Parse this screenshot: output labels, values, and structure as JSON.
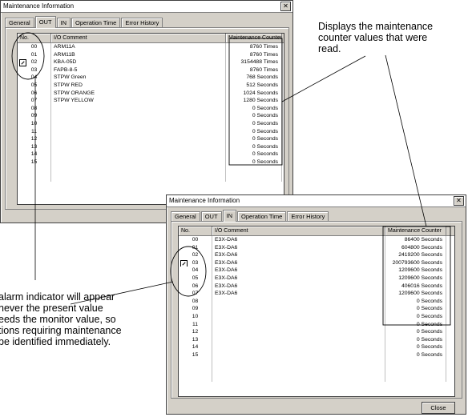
{
  "window1": {
    "title": "Maintenance Information",
    "close_glyph": "✕",
    "tabs": [
      "General",
      "OUT",
      "IN",
      "Operation Time",
      "Error History"
    ],
    "active_tab": 1,
    "headers": {
      "no": "No.",
      "comment": "I/O Comment",
      "counter": "Maintenance Counter"
    },
    "alarm_row": 2,
    "rows": [
      {
        "no": "00",
        "comment": "ARM11A",
        "counter": "8760 Times"
      },
      {
        "no": "01",
        "comment": "ARM11B",
        "counter": "8760 Times"
      },
      {
        "no": "02",
        "comment": "KBA-05D",
        "counter": "3154488 Times"
      },
      {
        "no": "03",
        "comment": "FAPB-8-5",
        "counter": "8760 Times"
      },
      {
        "no": "04",
        "comment": "STPW Green",
        "counter": "768 Seconds"
      },
      {
        "no": "05",
        "comment": "STPW RED",
        "counter": "512 Seconds"
      },
      {
        "no": "06",
        "comment": "STPW ORANGE",
        "counter": "1024 Seconds"
      },
      {
        "no": "07",
        "comment": "STPW YELLOW",
        "counter": "1280 Seconds"
      },
      {
        "no": "08",
        "comment": "",
        "counter": "0 Seconds"
      },
      {
        "no": "09",
        "comment": "",
        "counter": "0 Seconds"
      },
      {
        "no": "10",
        "comment": "",
        "counter": "0 Seconds"
      },
      {
        "no": "11",
        "comment": "",
        "counter": "0 Seconds"
      },
      {
        "no": "12",
        "comment": "",
        "counter": "0 Seconds"
      },
      {
        "no": "13",
        "comment": "",
        "counter": "0 Seconds"
      },
      {
        "no": "14",
        "comment": "",
        "counter": "0 Seconds"
      },
      {
        "no": "15",
        "comment": "",
        "counter": "0 Seconds"
      },
      {
        "no": "",
        "comment": "",
        "counter": ""
      },
      {
        "no": "",
        "comment": "",
        "counter": ""
      }
    ]
  },
  "window2": {
    "title": "Maintenance Information",
    "close_glyph": "✕",
    "tabs": [
      "General",
      "OUT",
      "IN",
      "Operation Time",
      "Error History"
    ],
    "active_tab": 2,
    "headers": {
      "no": "No.",
      "comment": "I/O Comment",
      "counter": "Maintenance Counter"
    },
    "alarm_row": 3,
    "rows": [
      {
        "no": "00",
        "comment": "E3X-DA6",
        "counter": "86400 Seconds"
      },
      {
        "no": "01",
        "comment": "E3X-DA6",
        "counter": "604800 Seconds"
      },
      {
        "no": "02",
        "comment": "E3X-DA6",
        "counter": "2419200 Seconds"
      },
      {
        "no": "03",
        "comment": "E3X-DA6",
        "counter": "200793600 Seconds"
      },
      {
        "no": "04",
        "comment": "E3X-DA6",
        "counter": "1209600 Seconds"
      },
      {
        "no": "05",
        "comment": "E3X-DA6",
        "counter": "1209600 Seconds"
      },
      {
        "no": "06",
        "comment": "E3X-DA6",
        "counter": "406016 Seconds"
      },
      {
        "no": "07",
        "comment": "E3X-DA6",
        "counter": "1209600 Seconds"
      },
      {
        "no": "08",
        "comment": "",
        "counter": "0 Seconds"
      },
      {
        "no": "09",
        "comment": "",
        "counter": "0 Seconds"
      },
      {
        "no": "10",
        "comment": "",
        "counter": "0 Seconds"
      },
      {
        "no": "11",
        "comment": "",
        "counter": "0 Seconds"
      },
      {
        "no": "12",
        "comment": "",
        "counter": "0 Seconds"
      },
      {
        "no": "13",
        "comment": "",
        "counter": "0 Seconds"
      },
      {
        "no": "14",
        "comment": "",
        "counter": "0 Seconds"
      },
      {
        "no": "15",
        "comment": "",
        "counter": "0 Seconds"
      },
      {
        "no": "",
        "comment": "",
        "counter": ""
      },
      {
        "no": "",
        "comment": "",
        "counter": ""
      },
      {
        "no": "",
        "comment": "",
        "counter": ""
      }
    ],
    "close_button": "Close"
  },
  "callouts": {
    "top_right": [
      "Displays the maintenance",
      "counter values that were",
      "read."
    ],
    "bottom_left": [
      "alarm indicator will appear",
      "never the present value",
      "eeds the monitor value, so",
      "tions requiring maintenance",
      "be identified immediately."
    ]
  }
}
